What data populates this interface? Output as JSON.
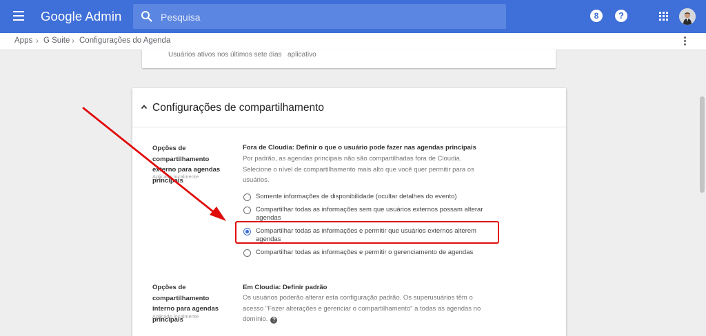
{
  "topbar": {
    "brand": "Google Admin",
    "search_placeholder": "Pesquisa",
    "badge": "8",
    "help": "?"
  },
  "breadcrumb": [
    "Apps",
    "G Suite",
    "Configurações do Agenda"
  ],
  "top_card": {
    "col1": "Usuários ativos nos últimos sete dias",
    "col2": "aplicativo"
  },
  "section": {
    "title": "Configurações de compartilhamento",
    "external": {
      "label": "Opções de compartilhamento externo para agendas principais",
      "sub": "Aplicado localmente",
      "heading": "Fora de Cloudia: Definir o que o usuário pode fazer nas agendas principais",
      "desc": "Por padrão, as agendas principais não são compartilhadas fora de Cloudia. Selecione o nível de compartilhamento mais alto que você quer permitir para os usuários.",
      "options": [
        "Somente informações de disponibilidade (ocultar detalhes do evento)",
        "Compartilhar todas as informações sem que usuários externos possam alterar agendas",
        "Compartilhar todas as informações e permitir que usuários externos alterem agendas",
        "Compartilhar todas as informações e permitir o gerenciamento de agendas"
      ],
      "selected_index": 2
    },
    "internal": {
      "label": "Opções de compartilhamento interno para agendas principais",
      "sub": "Aplicado localmente",
      "heading": "Em Cloudia: Definir padrão",
      "desc": "Os usuários poderão alterar esta configuração padrão. Os superusuários têm o acesso \"Fazer alterações e gerenciar o compartilhamento\" a todas as agendas no domínio."
    }
  },
  "colors": {
    "topbar": "#3f6fd8",
    "accent": "#3b6fd6",
    "annotation": "#e00b0b"
  }
}
